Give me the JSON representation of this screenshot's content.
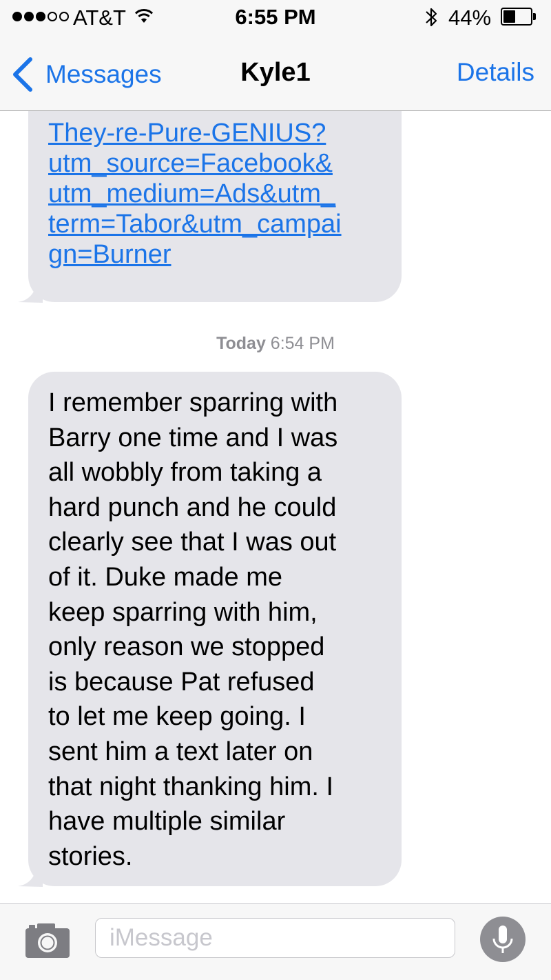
{
  "status_bar": {
    "signal_bars_filled": 3,
    "signal_bars_total": 5,
    "carrier": "AT&T",
    "wifi_icon": "wifi-icon",
    "time": "6:55 PM",
    "bluetooth_icon": "bluetooth-icon",
    "battery_percent": "44%",
    "battery_level": 0.44
  },
  "nav": {
    "back_label": "Messages",
    "back_icon": "chevron-left-icon",
    "title": "Kyle1",
    "details_label": "Details"
  },
  "messages": [
    {
      "direction": "incoming",
      "type": "link",
      "lines": [
        "They-re-Pure-GENIUS?",
        "utm_source=Facebook&",
        "utm_medium=Ads&utm_",
        "term=Tabor&utm_campai",
        "gn=Burner"
      ]
    },
    {
      "direction": "incoming",
      "type": "text",
      "lines": [
        "I remember sparring with",
        "Barry one time and I was",
        "all wobbly from taking a",
        "hard punch and he could",
        "clearly see that I was out",
        "of it. Duke made me",
        "keep sparring with him,",
        "only reason we stopped",
        "is because Pat refused",
        "to let me keep going. I",
        "sent him a text later on",
        "that night thanking him. I",
        "have multiple similar",
        "stories."
      ]
    }
  ],
  "timestamp": {
    "day": "Today",
    "time": "6:54 PM"
  },
  "input_bar": {
    "camera_icon": "camera-icon",
    "placeholder": "iMessage",
    "value": "",
    "mic_icon": "microphone-icon"
  },
  "colors": {
    "accent": "#1b74e8",
    "bubble_incoming": "#e5e5ea",
    "bar_background": "#f7f7f7",
    "timestamp_gray": "#8e8e93"
  }
}
